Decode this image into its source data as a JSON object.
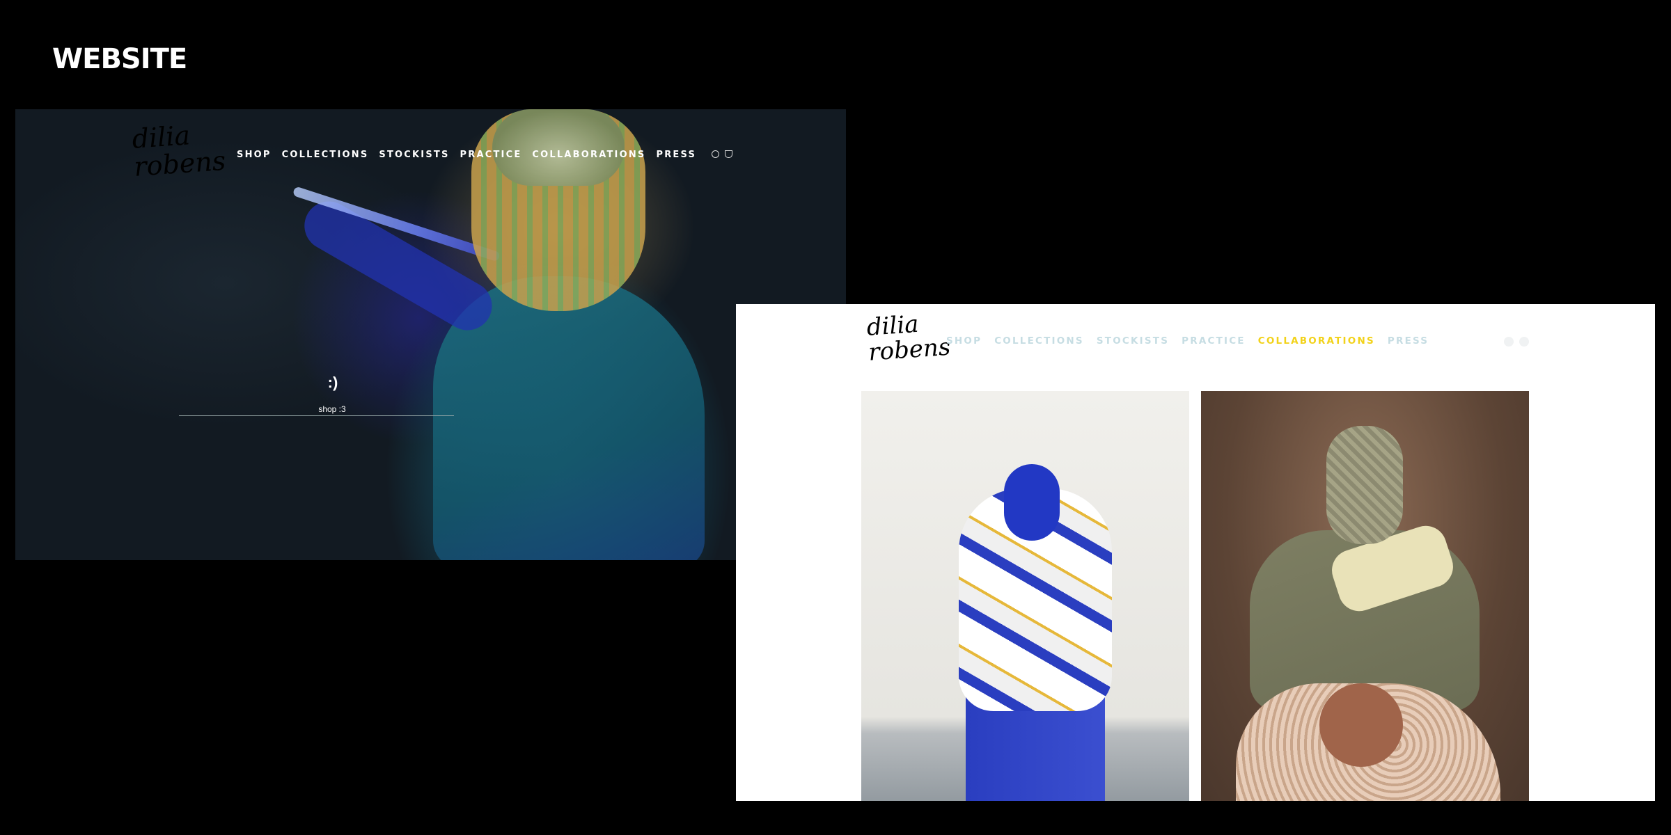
{
  "page": {
    "heading": "WEBSITE"
  },
  "dark_screen": {
    "logo_text": "dilia robens",
    "nav": [
      "SHOP",
      "COLLECTIONS",
      "STOCKISTS",
      "PRACTICE",
      "COLLABORATIONS",
      "PRESS"
    ],
    "icons": [
      "account-icon",
      "basket-icon"
    ],
    "cta_glyph": ":)",
    "cta_label": "shop :3"
  },
  "light_screen": {
    "logo_text": "dilia robens",
    "nav": [
      "SHOP",
      "COLLECTIONS",
      "STOCKISTS",
      "PRACTICE",
      "COLLABORATIONS",
      "PRESS"
    ],
    "active_nav": "COLLABORATIONS",
    "icons": [
      "account-icon",
      "basket-icon"
    ],
    "colors": {
      "nav_inactive": "#c6dde3",
      "nav_active": "#f2d21a"
    }
  }
}
